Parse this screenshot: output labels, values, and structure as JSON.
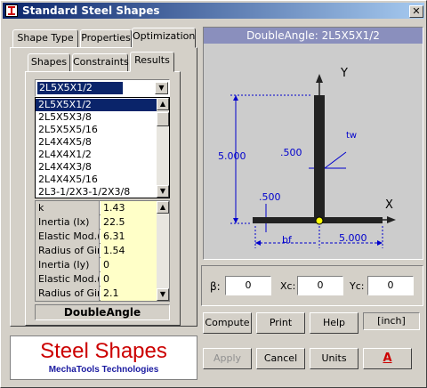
{
  "window": {
    "title": "Standard Steel Shapes",
    "close": "✕"
  },
  "tabs": {
    "main": [
      "Shape Type",
      "Properties",
      "Optimization"
    ],
    "sub": [
      "Shapes",
      "Constraints",
      "Results"
    ]
  },
  "combo": {
    "value": "2L5X5X1/2"
  },
  "shape_list": [
    "2L5X5X1/2",
    "2L5X5X3/8",
    "2L5X5X5/16",
    "2L4X4X5/8",
    "2L4X4X1/2",
    "2L4X4X3/8",
    "2L4X4X5/16",
    "2L3-1/2X3-1/2X3/8"
  ],
  "properties": [
    {
      "label": "k",
      "value": "1.43"
    },
    {
      "label": "Inertia (Ix)",
      "value": "22.5"
    },
    {
      "label": "Elastic Mod.(Sx)",
      "value": "6.31"
    },
    {
      "label": "Radius of Gir.(rx)",
      "value": "1.54"
    },
    {
      "label": "Inertia (Iy)",
      "value": "0"
    },
    {
      "label": "Elastic Mod.(Sy)",
      "value": "0"
    },
    {
      "label": "Radius of Gir.(ry)",
      "value": "2.1"
    }
  ],
  "shape_type_label": "DoubleAngle",
  "drawing": {
    "title": "DoubleAngle: 2L5X5X1/2",
    "y_axis": "Y",
    "x_axis": "X",
    "tw": "tw",
    "height": "5.000",
    "thickness_top": ".500",
    "thickness_bottom": ".500",
    "bf": "bf",
    "width": "5.000"
  },
  "orient": {
    "beta_label": "β:",
    "beta": "0",
    "xc_label": "Xc:",
    "xc": "0",
    "yc_label": "Yc:",
    "yc": "0"
  },
  "buttons": {
    "compute": "Compute",
    "print": "Print",
    "help": "Help",
    "units_display": "[inch]",
    "apply": "Apply",
    "cancel": "Cancel",
    "units": "Units",
    "font": "A"
  },
  "logo": {
    "title": "Steel Shapes",
    "subtitle": "MechaTools Technologies"
  },
  "colors": {
    "drawing_title_bg": "#8a8fbd",
    "drawing_bg": "#cccccc",
    "dim_blue": "#0000cc",
    "shape": "#222222",
    "logo_red": "#cc0000",
    "logo_blue": "#1a1aa0",
    "selection": "#0a246a"
  }
}
